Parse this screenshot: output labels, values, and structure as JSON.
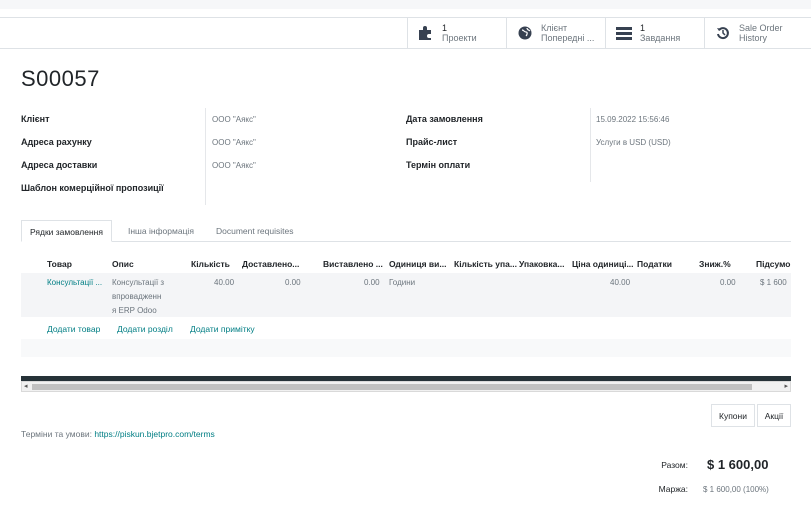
{
  "smart_buttons": [
    {
      "count": "1",
      "label": "Проекти",
      "icon": "puzzle-icon"
    },
    {
      "count": "",
      "label_line1": "Клієнт",
      "label_line2": "Попередні ...",
      "icon": "globe-icon"
    },
    {
      "count": "1",
      "label": "Завдання",
      "icon": "tasks-icon"
    },
    {
      "count": "",
      "label_line1": "Sale Order",
      "label_line2": "History",
      "icon": "history-icon"
    }
  ],
  "record": {
    "name": "S00057"
  },
  "fields_left": [
    {
      "label": "Клієнт",
      "value": "ООО \"Аякс\""
    },
    {
      "label": "Адреса рахунку",
      "value": "ООО \"Аякс\""
    },
    {
      "label": "Адреса доставки",
      "value": "ООО \"Аякс\""
    },
    {
      "label": "Шаблон комерційної пропозиції",
      "value": ""
    }
  ],
  "fields_right": [
    {
      "label": "Дата замовлення",
      "value": "15.09.2022 15:56:46"
    },
    {
      "label": "Прайс-лист",
      "value": "Услуги в USD (USD)"
    },
    {
      "label": "Термін оплати",
      "value": ""
    }
  ],
  "tabs": [
    "Рядки замовлення",
    "Інша інформація",
    "Document requisites"
  ],
  "table": {
    "headers": [
      "Товар",
      "Опис",
      "Кількість",
      "Доставлено...",
      "Виставлено ...",
      "Одиниця ви...",
      "Кількість упа...",
      "Упаковка...",
      "Ціна одиниці...",
      "Податки",
      "Зниж.%",
      "Підсумо"
    ],
    "rows": [
      {
        "product": "Консультації ...",
        "desc_line1": "Консультації з",
        "desc_line2": "впровадженн",
        "desc_line3": "я ERP Odoo",
        "qty": "40.00",
        "delivered": "0.00",
        "invoiced": "0.00",
        "uom": "Години",
        "price": "40.00",
        "discount": "0.00",
        "subtotal": "$ 1 600"
      }
    ],
    "add_links": [
      "Додати товар",
      "Додати розділ",
      "Додати примітку"
    ]
  },
  "buttons": {
    "coupons": "Купони",
    "promotions": "Акції"
  },
  "terms": {
    "label": "Терміни та умови:",
    "link": "https://piskun.bjetpro.com/terms"
  },
  "totals": {
    "total_label": "Разом:",
    "total_value": "$ 1 600,00",
    "margin_label": "Маржа:",
    "margin_value": "$ 1 600,00 (100%)"
  },
  "colors": {
    "accent": "#017e84",
    "muted": "#6c757d",
    "dark_bar": "#263238"
  }
}
